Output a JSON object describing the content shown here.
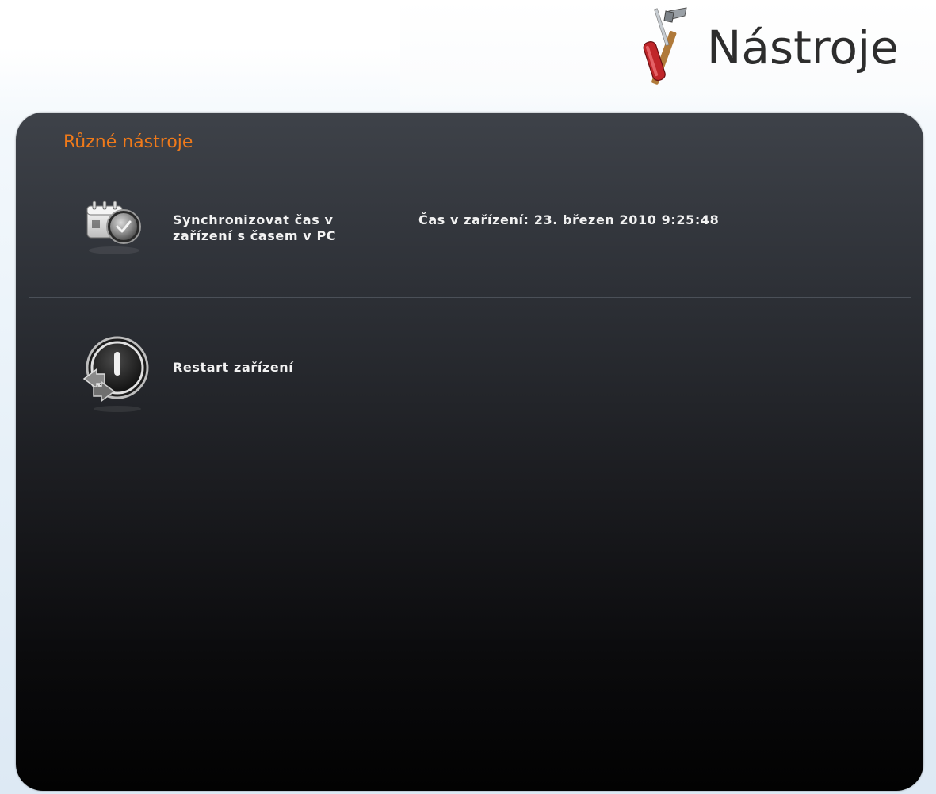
{
  "header": {
    "title": "Nástroje",
    "icon": "tools-icon"
  },
  "panel": {
    "title": "Různé nástroje",
    "items": [
      {
        "icon": "calendar-clock-icon",
        "label_line1": "Synchronizovat čas v",
        "label_line2": "zařízení s časem v PC",
        "info": "Čas v zařízení: 23. březen 2010 9:25:48"
      },
      {
        "icon": "restart-power-icon",
        "label": "Restart zařízení"
      }
    ]
  },
  "colors": {
    "accent": "#f07a1a",
    "panel_top": "#3e4249",
    "panel_bottom": "#020202",
    "text": "#f2f2f2"
  }
}
